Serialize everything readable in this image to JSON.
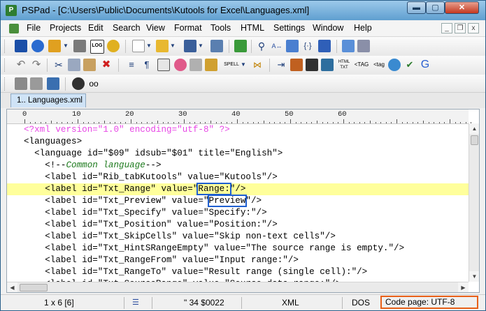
{
  "window": {
    "title": "PSPad - [C:\\Users\\Public\\Documents\\Kutools for Excel\\Languages.xml]",
    "controls": {
      "minimize": "▬",
      "maximize": "▢",
      "close": "✕"
    },
    "colors": {
      "title_gradient_top": "#9cc9ea",
      "title_gradient_bottom": "#5f9fd0",
      "close": "#c4381f"
    }
  },
  "menubar": {
    "items": [
      "File",
      "Projects",
      "Edit",
      "Search",
      "View",
      "Format",
      "Tools",
      "HTML",
      "Settings",
      "Window",
      "Help"
    ],
    "mdi_controls": {
      "minimize": "_",
      "restore": "❐",
      "close": "x"
    }
  },
  "toolbars": {
    "row1": [
      "cube-icon",
      "cubes-icon",
      "open-project-icon",
      "dropdown-icon",
      "clipboard-icon",
      "log-icon",
      "gear-icon",
      "new-file-icon",
      "open-folder-icon",
      "save-icon",
      "save-all-icon",
      "tree-icon",
      "search-icon",
      "replace-icon",
      "find-in-files-icon",
      "brackets-icon",
      "bookmark-icon",
      "preview-icon",
      "print-icon"
    ],
    "row2": [
      "undo-icon",
      "redo-icon",
      "cut-icon",
      "copy-icon",
      "paste-icon",
      "delete-icon",
      "wrap-icon",
      "paragraph-icon",
      "block-select-icon",
      "palette-icon",
      "lock-open-icon",
      "lock-icon",
      "spell-icon",
      "merge-icon",
      "format-code-icon",
      "package-icon",
      "hex-icon",
      "encoding-icon",
      "html-txt-icon",
      "tag-icon",
      "tag-small-icon",
      "globe-icon",
      "validate-icon",
      "google-icon"
    ],
    "row3": [
      "gray-square-icon",
      "gray-file-icon",
      "monitor-icon",
      "record-icon",
      "glasses-icon"
    ],
    "labels": {
      "spell": "SPELL",
      "html": "HTML",
      "txt": "TXT",
      "tag": "<TAG",
      "tag_small": "<tag",
      "google": "G"
    }
  },
  "tabs": [
    {
      "label": "1.. Languages.xml"
    }
  ],
  "ruler": {
    "labels": [
      "0",
      "10",
      "20",
      "30",
      "40",
      "50",
      "60"
    ]
  },
  "editor": {
    "current_line_color": "#ffff9b",
    "lines": [
      {
        "segments": [
          {
            "t": "<?xml version=\"1.0\" encoding=\"utf-8\" ?>",
            "c": "pi"
          }
        ]
      },
      {
        "segments": [
          {
            "t": "<languages>"
          }
        ]
      },
      {
        "segments": [
          {
            "t": "  <language id="
          },
          {
            "t": "\"$09\"",
            "c": ""
          },
          {
            "t": " idsub=\"$01\" title=\"English\">"
          }
        ]
      },
      {
        "segments": [
          {
            "t": "    <!--"
          },
          {
            "t": "Common language",
            "c": "comment"
          },
          {
            "t": "-->"
          }
        ]
      },
      {
        "segments": [
          {
            "t": "    <label id=\"Rib_tabKutools\" value=\"Kutools\"/>"
          }
        ]
      },
      {
        "current": true,
        "segments": [
          {
            "t": "    <label id=\"Txt_Range\" value=\""
          },
          {
            "t": "Range:",
            "c": "box"
          },
          {
            "t": "\"/>"
          }
        ]
      },
      {
        "segments": [
          {
            "t": "    <label id=\"Txt_Preview\" value=\""
          },
          {
            "t": "Preview",
            "c": "box"
          },
          {
            "t": "\"/>"
          }
        ]
      },
      {
        "segments": [
          {
            "t": "    <label id=\"Txt_Specify\" value=\"Specify:\"/>"
          }
        ]
      },
      {
        "segments": [
          {
            "t": "    <label id=\"Txt_Position\" value=\"Position:\"/>"
          }
        ]
      },
      {
        "segments": [
          {
            "t": "    <label id=\"Txt_SkipCells\" value=\"Skip non-text cells\"/>"
          }
        ]
      },
      {
        "segments": [
          {
            "t": "    <label id=\"Txt_HintSRangeEmpty\" value=\"The source range is empty.\"/>"
          }
        ]
      },
      {
        "segments": [
          {
            "t": "    <label id=\"Txt_RangeFrom\" value=\"Input range:\"/>"
          }
        ]
      },
      {
        "segments": [
          {
            "t": "    <label id=\"Txt_RangeTo\" value=\"Result range (single cell):\"/>"
          }
        ]
      },
      {
        "segments": [
          {
            "t": "    <label id=\"Txt_SourceRange\" value=\"Source data range:\"/>"
          }
        ]
      }
    ]
  },
  "statusbar": {
    "position": "1 x 6   [6]",
    "char_info": "\"   34  $0022",
    "syntax": "XML",
    "line_end": "DOS",
    "code_page": "Code page: UTF-8",
    "highlight_color": "#e8611a"
  }
}
